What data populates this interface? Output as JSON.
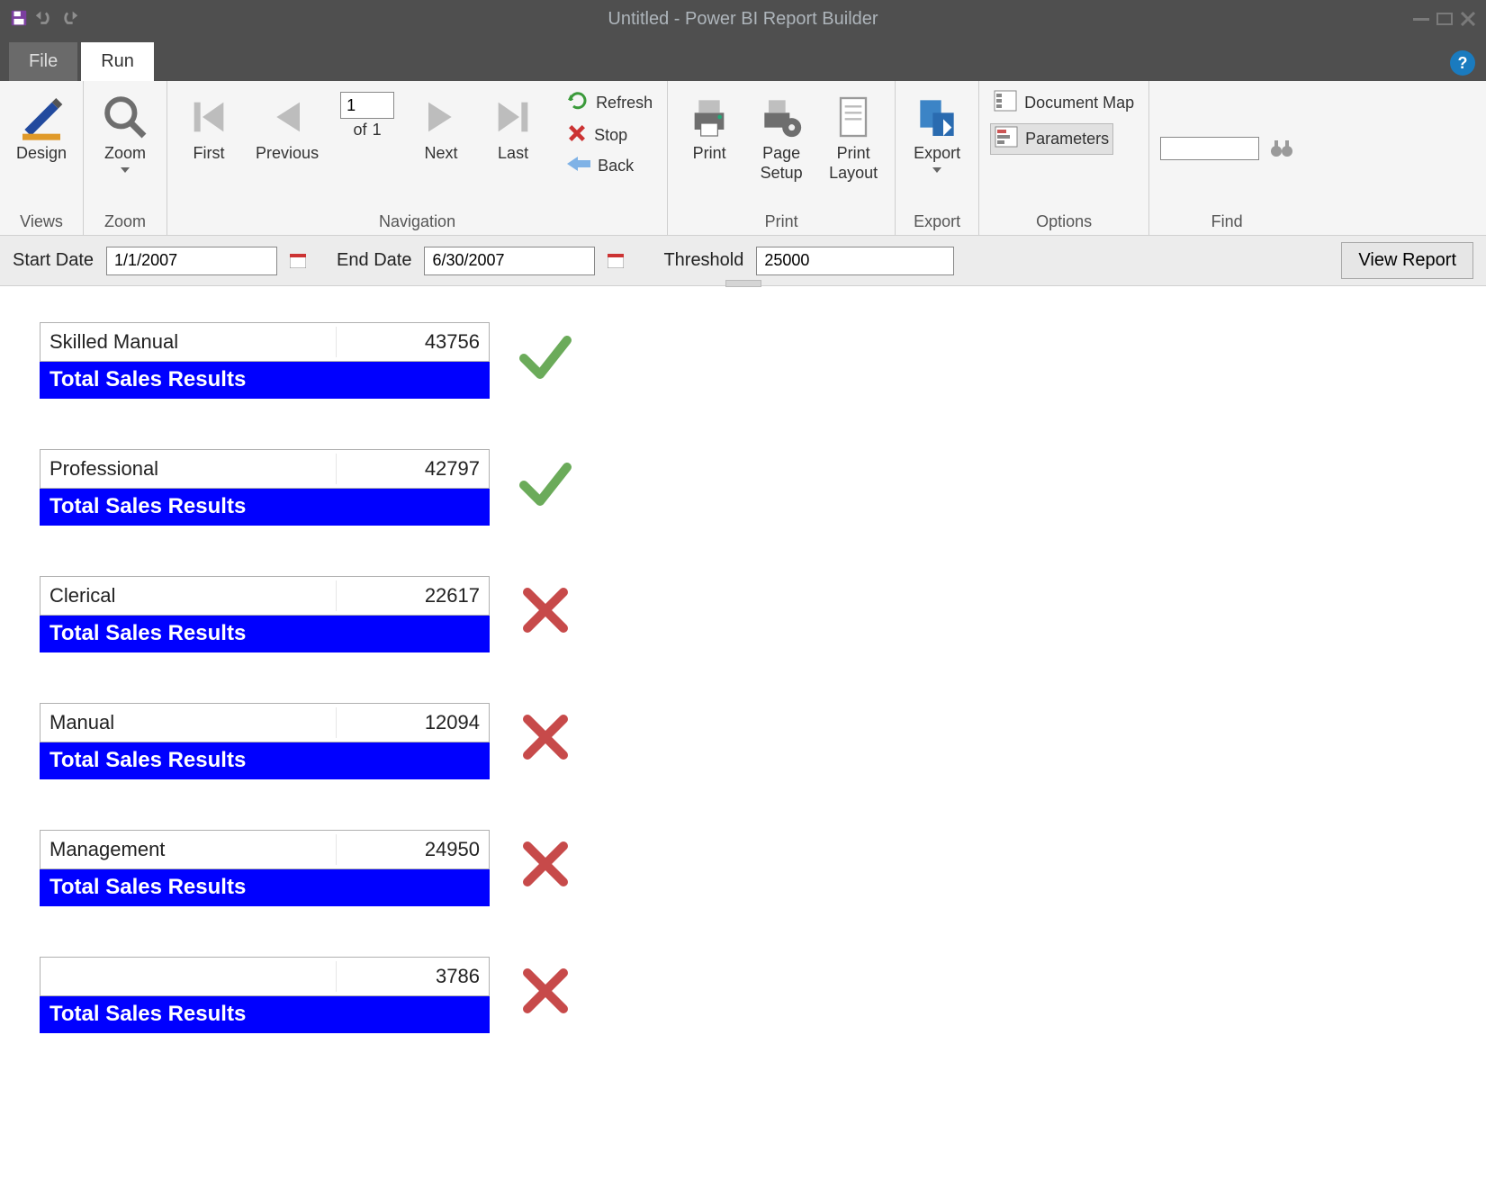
{
  "window": {
    "title": "Untitled - Power BI Report Builder"
  },
  "tabs": {
    "file": "File",
    "run": "Run"
  },
  "ribbon": {
    "groups": {
      "views": {
        "label": "Views",
        "design": "Design"
      },
      "zoom": {
        "label": "Zoom",
        "zoom": "Zoom"
      },
      "navigation": {
        "label": "Navigation",
        "first": "First",
        "previous": "Previous",
        "page_value": "1",
        "of_label": "of",
        "total_pages": "1",
        "next": "Next",
        "last": "Last",
        "refresh": "Refresh",
        "stop": "Stop",
        "back": "Back"
      },
      "print": {
        "label": "Print",
        "print": "Print",
        "page_setup": "Page\nSetup",
        "print_layout": "Print\nLayout"
      },
      "export": {
        "label": "Export",
        "export": "Export"
      },
      "options": {
        "label": "Options",
        "doc_map": "Document Map",
        "parameters": "Parameters"
      },
      "find": {
        "label": "Find"
      }
    }
  },
  "params": {
    "start_date_label": "Start Date",
    "start_date_value": "1/1/2007",
    "end_date_label": "End Date",
    "end_date_value": "6/30/2007",
    "threshold_label": "Threshold",
    "threshold_value": "25000",
    "view_report": "View Report"
  },
  "report": {
    "total_label": "Total Sales Results",
    "rows": [
      {
        "name": "Skilled Manual",
        "value": "43756",
        "pass": true
      },
      {
        "name": "Professional",
        "value": "42797",
        "pass": true
      },
      {
        "name": "Clerical",
        "value": "22617",
        "pass": false
      },
      {
        "name": "Manual",
        "value": "12094",
        "pass": false
      },
      {
        "name": "Management",
        "value": "24950",
        "pass": false
      },
      {
        "name": "",
        "value": "3786",
        "pass": false
      }
    ]
  },
  "icons": {
    "save": "save",
    "undo": "undo",
    "redo": "redo",
    "minimize": "minimize",
    "restore": "restore",
    "close": "close",
    "help": "?"
  }
}
